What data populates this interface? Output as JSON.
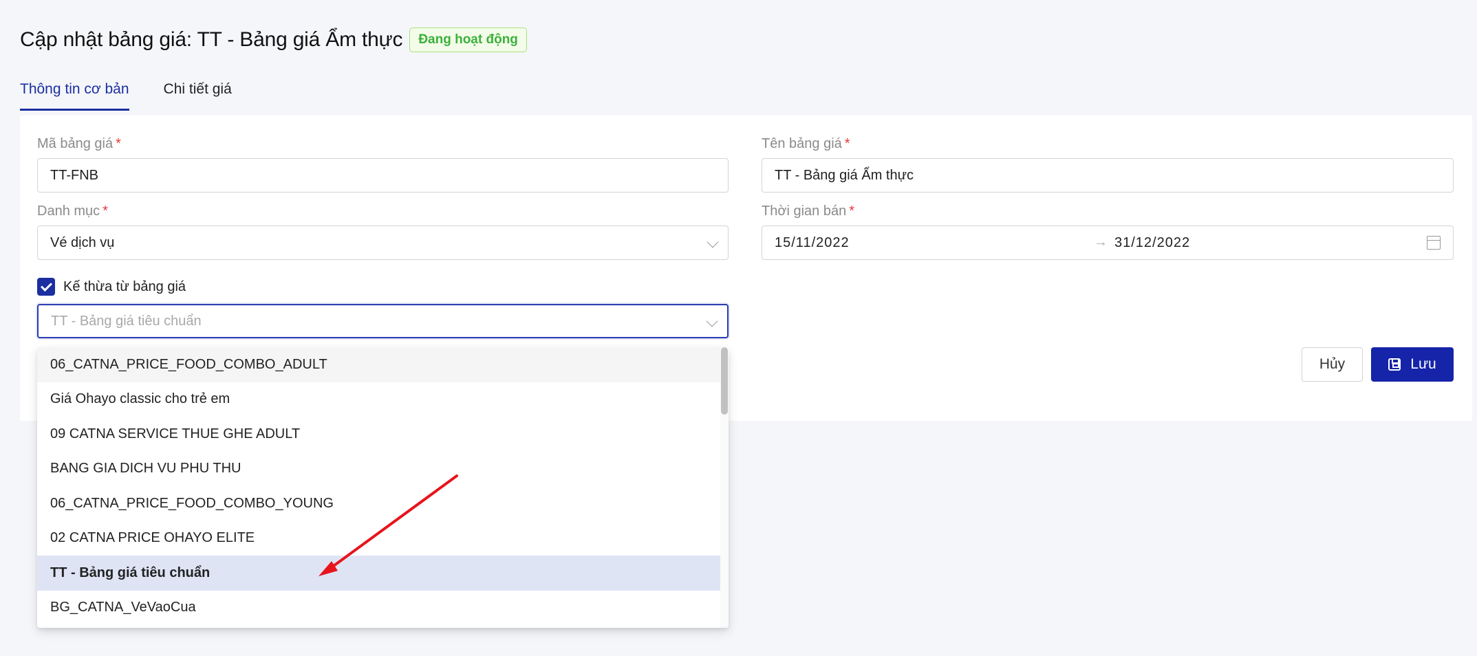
{
  "page": {
    "title": "Cập nhật bảng giá: TT - Bảng giá Ẩm thực",
    "status": "Đang hoạt động"
  },
  "tabs": [
    {
      "label": "Thông tin cơ bản",
      "active": true
    },
    {
      "label": "Chi tiết giá",
      "active": false
    }
  ],
  "form": {
    "code": {
      "label": "Mã bảng giá",
      "required": "*",
      "value": "TT-FNB"
    },
    "name": {
      "label": "Tên bảng giá",
      "required": "*",
      "value": "TT - Bảng giá Ẩm thực"
    },
    "category": {
      "label": "Danh mục",
      "required": "*",
      "value": "Vé dịch vụ"
    },
    "sale_period": {
      "label": "Thời gian bán",
      "required": "*",
      "start": "15/11/2022",
      "separator": "→",
      "end": "31/12/2022"
    },
    "inherit": {
      "label": "Kế thừa từ bảng giá",
      "checked": true,
      "placeholder": "TT - Bảng giá tiêu chuẩn"
    }
  },
  "actions": {
    "cancel": "Hủy",
    "save": "Lưu"
  },
  "dropdown": {
    "items": [
      "06_CATNA_PRICE_FOOD_COMBO_ADULT",
      "Giá Ohayo classic cho trẻ em",
      "09 CATNA SERVICE THUE GHE ADULT",
      "BANG GIA DICH VU PHU THU",
      "06_CATNA_PRICE_FOOD_COMBO_YOUNG",
      "02 CATNA PRICE OHAYO ELITE",
      "TT - Bảng giá tiêu chuẩn",
      "BG_CATNA_VeVaoCua"
    ],
    "hovered_index": 0,
    "selected_index": 6
  },
  "colors": {
    "primary": "#1524a8",
    "status_green": "#3bb13b",
    "annotation_arrow": "#e8141b"
  }
}
